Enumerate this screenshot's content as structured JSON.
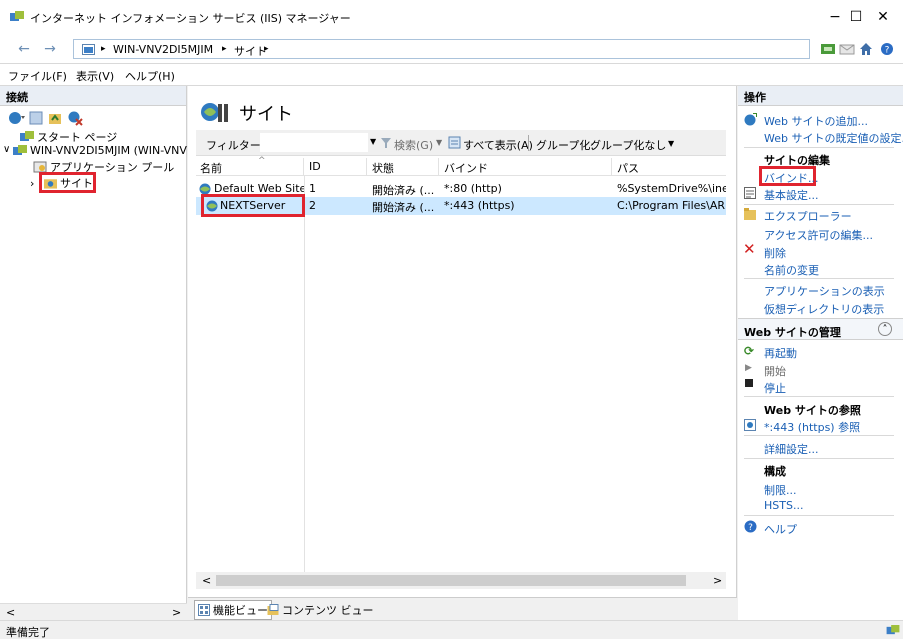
{
  "window": {
    "title": "インターネット インフォメーション サービス (IIS) マネージャー",
    "minimize": "−",
    "maximize": "☐",
    "close": "✕"
  },
  "address": {
    "back": "←",
    "forward": "→",
    "sep": "▸",
    "server": "WIN-VNV2DI5MJIM",
    "page": "サイト"
  },
  "menu": {
    "file": "ファイル(F)",
    "view": "表示(V)",
    "help": "ヘルプ(H)"
  },
  "connections": {
    "header": "接続",
    "start_page": "スタート ページ",
    "server_node": "WIN-VNV2DI5MJIM (WIN-VNV",
    "app_pools": "アプリケーション プール",
    "sites": "サイト",
    "expand_glyph": "∨",
    "collapse_glyph": "›",
    "scroll_left": "<",
    "scroll_right": ">"
  },
  "center": {
    "page_title": "サイト",
    "filter_label": "フィルター:",
    "filter_value": "",
    "search_label": "検索(G)",
    "show_all_label": "すべて表示(A)",
    "group_label": "グループ化:",
    "group_value": "グループ化なし",
    "columns": [
      "名前",
      "ID",
      "状態",
      "バインド",
      "パス"
    ],
    "rows": [
      {
        "name": "Default Web Site",
        "id": "1",
        "state": "開始済み (...",
        "binding": "*:80 (http)",
        "path": "%SystemDrive%\\inet"
      },
      {
        "name": "NEXTServer",
        "id": "2",
        "state": "開始済み (...",
        "binding": "*:443 (https)",
        "path": "C:\\Program Files\\AR"
      }
    ],
    "features_view": "機能ビュー",
    "content_view": "コンテンツ ビュー",
    "scroll_left": "<",
    "scroll_right": ">"
  },
  "actions": {
    "header": "操作",
    "add_site": "Web サイトの追加...",
    "site_defaults": "Web サイトの既定値の設定...",
    "edit_site_header": "サイトの編集",
    "bindings": "バインド...",
    "basic_settings": "基本設定...",
    "explore": "エクスプローラー",
    "edit_permissions": "アクセス許可の編集...",
    "remove": "削除",
    "rename": "名前の変更",
    "view_apps": "アプリケーションの表示",
    "view_vdirs": "仮想ディレクトリの表示",
    "manage_header": "Web サイトの管理",
    "restart": "再起動",
    "start": "開始",
    "stop": "停止",
    "browse_header": "Web サイトの参照",
    "browse_link": "*:443 (https) 参照",
    "advanced": "詳細設定...",
    "config_header": "構成",
    "limits": "制限...",
    "hsts": "HSTS...",
    "help": "ヘルプ",
    "collapse_glyph": "˄"
  },
  "status": {
    "text": "準備完了"
  },
  "colors": {
    "highlight_box": "#e0242f",
    "selection": "#cce8ff",
    "link": "#1a5fb4",
    "panel_header": "#e9eef5"
  }
}
